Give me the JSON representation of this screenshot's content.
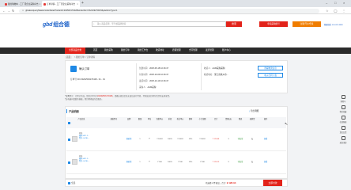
{
  "browser": {
    "tabs": [
      {
        "label": "我的购物车 - 工厂邦企业采购平台"
      },
      {
        "label": "订单详情 - 工厂邦企业采购平台"
      }
    ],
    "new_tab": "+",
    "url": "gl/sales/queryMaster/orderDetail?orderId=202503170428&orderNo=OS2109270015&platformType=1"
  },
  "header": {
    "logo_latin": "gbd",
    "logo_cn": "组合德",
    "search_placeholder": "输入商品名称、型号或品牌搜索",
    "search_button": "搜索",
    "btn_apply": "申请采购账号",
    "btn_register": "注册/开户/登录",
    "btn_app": "APP",
    "phone": "客服热线: 400-692-8888",
    "colors": {
      "brand_blue": "#1e62c9",
      "brand_red": "#e2231a",
      "nav_dark": "#2b2b2b"
    }
  },
  "nav": {
    "items": [
      "全部商品分类",
      "首页",
      "我的采购",
      "我的订单",
      "我的工作台",
      "收货地址",
      "质保管理",
      "合同管理",
      "发票管理",
      "账户中心"
    ]
  },
  "breadcrumb": {
    "tag": "首页",
    "sep": ">",
    "items": [
      "我的订单",
      "订单详情"
    ]
  },
  "order": {
    "status": "确认订单",
    "order_no": "订单号 NO.F0202503170428 - 01 - 01",
    "created_label": "创建时间:",
    "created": "2025-05-18 10:26:47",
    "buyer_label": "采购人:",
    "buyer": "AAM采购",
    "pay_label": "付款时间:",
    "pay": "2025-10-09 10:26:47",
    "ship_label": "发货时间:",
    "ship": "2025-10-19 10:26:47",
    "recv_label": "收货人:",
    "recv": "AAM采购采购",
    "addr_label": "收货地址:",
    "addr": "浙江省杭州市...",
    "btn_track": "查看物流信息",
    "btn_contract": "电子合同下载"
  },
  "notice": {
    "line1_prefix": "*温馨提示：订单已生成，您的订单号为",
    "line1_red": "F0202503170428",
    "line1_suffix": "，请确认商品信息无误后进行付款，付款成功后将为您尽快安排发货。",
    "line2": "*如有疑问请联系客服，我们将竭诚为您服务。"
  },
  "products": {
    "title": "产品明细",
    "export_label": "导出明细",
    "columns": [
      "产品信息",
      "规格型号",
      "品牌",
      "数量",
      "单位",
      "含税单价",
      "折扣",
      "折后单价",
      "税率",
      "小计金额",
      "合计",
      "货期(天)",
      "物流",
      "退换货",
      "操作"
    ],
    "rows": [
      {
        "name": "开关",
        "code": "编码:HP1.2...",
        "spec": "型号:G:PBL...",
        "brand": "施耐德",
        "qty": "1",
        "unit": "个",
        "price": "¥ 106.8",
        "discount": "100%",
        "net_price": "¥ 106.8",
        "tax": "13%",
        "subtotal": "¥ 106.8",
        "total": "¥ 120.68",
        "lead": "3",
        "logistics": "待发货",
        "return": "无",
        "op": "查看"
      },
      {
        "name": "开关",
        "code": "编码:HP1.2...",
        "spec": "型号:G:PBL...",
        "brand": "施耐德",
        "qty": "1",
        "unit": "个",
        "price": "¥ 106",
        "discount": "100%",
        "net_price": "¥ 106",
        "tax": "13%",
        "subtotal": "¥ 106",
        "total": "¥ 120.15",
        "lead": "3",
        "logistics": "待发货",
        "return": "无",
        "op": "查看"
      }
    ]
  },
  "footer": {
    "select_all": "全选",
    "summary_prefix": "已选择 2 件商品，合计:",
    "summary_total": "¥ 128.34",
    "action": "立即付款"
  },
  "right_sidebar": [
    "购物车",
    "我的收藏",
    "在线客服",
    "意见反馈",
    "返回顶部"
  ],
  "cursor": "↖"
}
